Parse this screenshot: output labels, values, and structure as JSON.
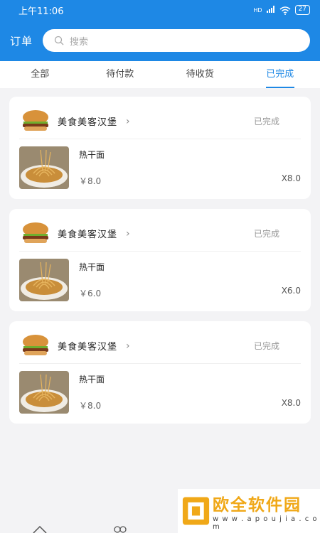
{
  "status_bar": {
    "time": "上午11:06",
    "signal": "HD",
    "battery": "27"
  },
  "header": {
    "title": "订单",
    "search_placeholder": "搜索"
  },
  "tabs": [
    {
      "label": "全部",
      "active": false
    },
    {
      "label": "待付款",
      "active": false
    },
    {
      "label": "待收货",
      "active": false
    },
    {
      "label": "已完成",
      "active": true
    }
  ],
  "orders": [
    {
      "shop": "美食美客汉堡",
      "status": "已完成",
      "item": "热干面",
      "price": "￥8.0",
      "qty": "X8.0"
    },
    {
      "shop": "美食美客汉堡",
      "status": "已完成",
      "item": "热干面",
      "price": "￥6.0",
      "qty": "X6.0"
    },
    {
      "shop": "美食美客汉堡",
      "status": "已完成",
      "item": "热干面",
      "price": "￥8.0",
      "qty": "X8.0"
    }
  ],
  "watermark": {
    "main": "欧全软件园",
    "sub": "w w w . a p o u j i a . c o m"
  },
  "colors": {
    "primary": "#1e88e5",
    "background": "#f3f3f5"
  }
}
